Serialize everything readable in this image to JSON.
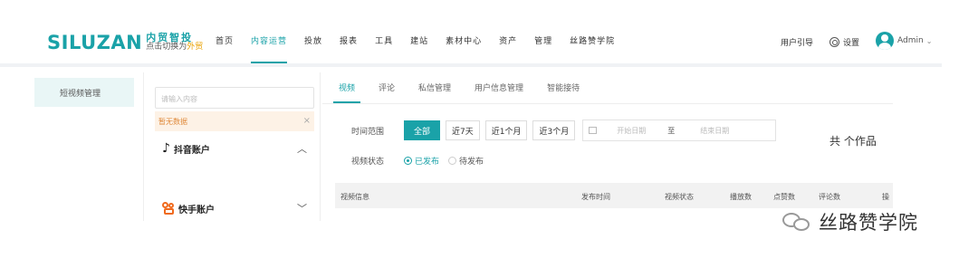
{
  "logo": {
    "word": "SILUZAN",
    "cn": "内贸智投",
    "switch_prefix": "点击切换为",
    "switch_link": "外贸"
  },
  "nav": [
    "首页",
    "内容运营",
    "投放",
    "报表",
    "工具",
    "建站",
    "素材中心",
    "资产",
    "管理",
    "丝路赞学院"
  ],
  "nav_active": 1,
  "header_right": {
    "guide": "用户引导",
    "settings": "设置",
    "user": "Admin",
    "user_icon": "avatar-icon"
  },
  "sidebar": {
    "items": [
      {
        "label": "短视频管理",
        "active": true
      }
    ]
  },
  "panel": {
    "search_placeholder": "请输入内容",
    "nodata": "暂无数据",
    "accounts": [
      {
        "label": "抖音账户",
        "icon": "tiktok-icon",
        "expanded": true
      },
      {
        "label": "快手账户",
        "icon": "kuaishou-icon",
        "expanded": false
      }
    ]
  },
  "tabs": [
    "视频",
    "评论",
    "私信管理",
    "用户信息管理",
    "智能接待"
  ],
  "tab_active": 0,
  "filters": {
    "time_label": "时间范围",
    "time_options": [
      "全部",
      "近7天",
      "近1个月",
      "近3个月"
    ],
    "time_selected": "全部",
    "start_placeholder": "开始日期",
    "to": "至",
    "end_placeholder": "结束日期",
    "status_label": "视频状态",
    "status_options": [
      "已发布",
      "待发布"
    ],
    "status_selected": "已发布"
  },
  "table": {
    "columns": [
      "视频信息",
      "发布时间",
      "视频状态",
      "播放数",
      "点赞数",
      "评论数",
      "操"
    ]
  },
  "works_count_text": "共 个作品",
  "watermark": "丝路赞学院",
  "colors": {
    "accent": "#1aa2a8",
    "warning_bg": "#fdf2e6",
    "warning_text": "#e08a3c",
    "brand_orange": "#e8a000"
  }
}
